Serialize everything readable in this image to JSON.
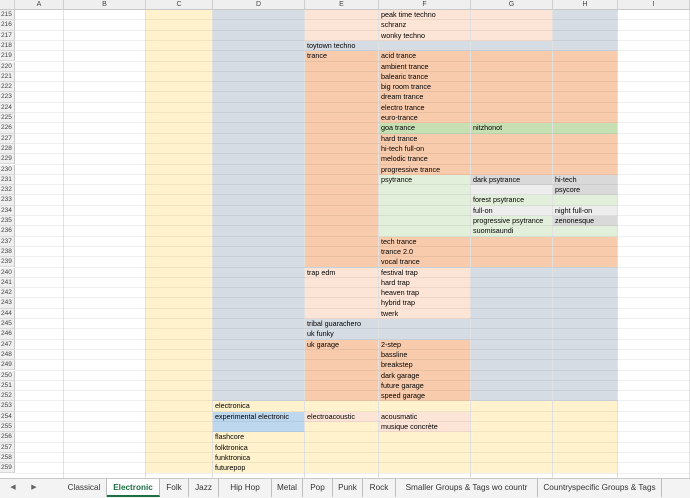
{
  "colors": {
    "yellow": "#fff2cc",
    "gray_blue": "#d6dce4",
    "orange": "#f8cbad",
    "light_orange": "#fce4d6",
    "green": "#c6e0b4",
    "light_green": "#e2efda",
    "gray": "#d9d9d9",
    "light_gray": "#ededed",
    "blue": "#bdd7ee",
    "accent": "#1d6f42"
  },
  "columns": [
    "A",
    "B",
    "C",
    "D",
    "E",
    "F",
    "G",
    "H",
    "I"
  ],
  "rows": [
    "215",
    "216",
    "217",
    "218",
    "219",
    "220",
    "221",
    "222",
    "223",
    "224",
    "225",
    "226",
    "227",
    "228",
    "229",
    "230",
    "231",
    "232",
    "233",
    "234",
    "235",
    "236",
    "237",
    "238",
    "239",
    "240",
    "241",
    "242",
    "243",
    "244",
    "245",
    "246",
    "247",
    "248",
    "249",
    "250",
    "251",
    "252",
    "253",
    "254",
    "255",
    "256",
    "257",
    "258",
    "259"
  ],
  "cells": {
    "F215": "peak time techno",
    "F216": "schranz",
    "F217": "wonky techno",
    "E218": "toytown techno",
    "E219": "trance",
    "F219": "acid trance",
    "F220": "ambient trance",
    "F221": "balearic trance",
    "F222": "big room trance",
    "F223": "dream trance",
    "F224": "electro trance",
    "F225": "euro-trance",
    "F226": "goa trance",
    "G226": "nitzhonot",
    "F227": "hard trance",
    "F228": "hi-tech full-on",
    "F229": "melodic trance",
    "F230": "progressive trance",
    "F231": "psytrance",
    "G231": "dark psytrance",
    "H231": "hi-tech",
    "H232": "psycore",
    "G233": "forest psytrance",
    "G234": "full-on",
    "H234": "night full-on",
    "G235": "progressive psytrance",
    "H235": "zenonesque",
    "G236": "suomisaundi",
    "F237": "tech trance",
    "F238": "trance 2.0",
    "F239": "vocal trance",
    "E240": "trap edm",
    "F240": "festival trap",
    "F241": "hard trap",
    "F242": "heaven trap",
    "F243": "hybrid trap",
    "F244": "twerk",
    "E245": "tribal guarachero",
    "E246": "uk funky",
    "E247": "uk garage",
    "F247": "2-step",
    "F248": "bassline",
    "F249": "breakstep",
    "F250": "dark garage",
    "F251": "future garage",
    "F252": "speed garage",
    "D253": "electronica",
    "D254": "experimental electronic",
    "E254": "electroacoustic",
    "F254": "acousmatic",
    "F255": "musique concrète",
    "D256": "flashcore",
    "D257": "folktronica",
    "D258": "funktronica",
    "D259": "futurepop"
  },
  "tabs": [
    "Classical",
    "Electronic",
    "Folk",
    "Jazz",
    "Hip Hop",
    "Metal",
    "Pop",
    "Punk",
    "Rock",
    "Smaller Groups & Tags wo countr",
    "Countryspecific Groups & Tags"
  ],
  "active_tab": "Electronic",
  "nav": {
    "prev_icon": "◀",
    "next_icon": "▶"
  }
}
